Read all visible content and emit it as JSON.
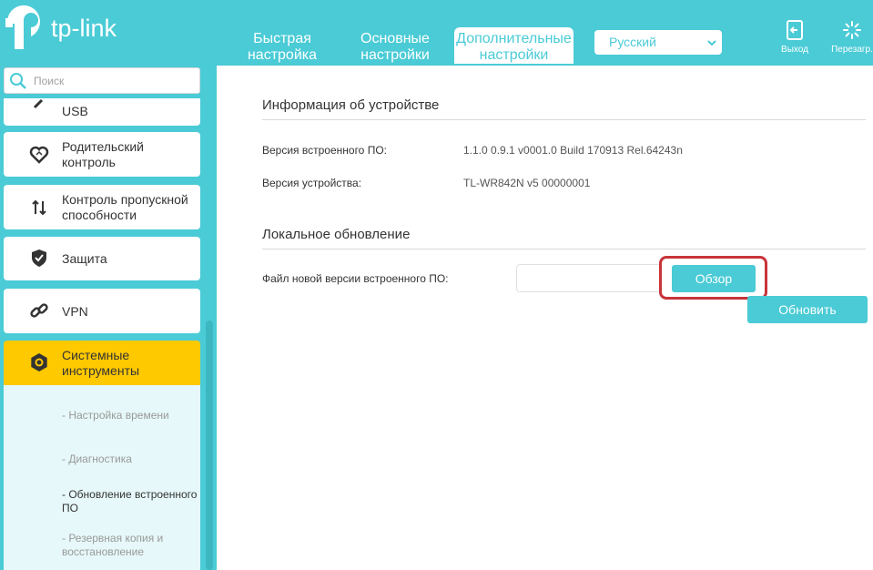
{
  "header": {
    "logo_text": "tp-link",
    "tabs": [
      {
        "label_line1": "Быстрая",
        "label_line2": "настройка"
      },
      {
        "label_line1": "Основные",
        "label_line2": "настройки"
      },
      {
        "label_line1": "Дополнительные",
        "label_line2": "настройки"
      }
    ],
    "language": "Русский",
    "exit_label": "Выход",
    "reboot_label": "Перезагр."
  },
  "sidebar": {
    "search_placeholder": "Поиск",
    "items": [
      {
        "label": "USB",
        "icon": "usb-icon"
      },
      {
        "label_line1": "Родительский",
        "label_line2": "контроль",
        "icon": "heart-icon"
      },
      {
        "label_line1": "Контроль пропускной",
        "label_line2": "способности",
        "icon": "bandwidth-arrows-icon"
      },
      {
        "label": "Защита",
        "icon": "shield-icon"
      },
      {
        "label": "VPN",
        "icon": "link-icon"
      },
      {
        "label_line1": "Системные",
        "label_line2": "инструменты",
        "icon": "gear-icon"
      }
    ],
    "submenu": [
      {
        "label": "- Настройка времени"
      },
      {
        "label": "- Диагностика"
      },
      {
        "label_line1": "- Обновление встроенного",
        "label_line2": "ПО"
      },
      {
        "label_line1": "- Резервная копия и",
        "label_line2": "восстановление"
      }
    ]
  },
  "main": {
    "device_info_title": "Информация об устройстве",
    "fw_version_label": "Версия встроенного ПО:",
    "fw_version_value": "1.1.0 0.9.1 v0001.0 Build 170913 Rel.64243n",
    "hw_version_label": "Версия устройства:",
    "hw_version_value": "TL-WR842N v5 00000001",
    "local_update_title": "Локальное обновление",
    "new_fw_label": "Файл новой версии встроенного ПО:",
    "browse_label": "Обзор",
    "update_label": "Обновить"
  },
  "colors": {
    "accent": "#4acbd6",
    "active_menu": "#ffc900",
    "highlight_border": "#c8343a"
  }
}
